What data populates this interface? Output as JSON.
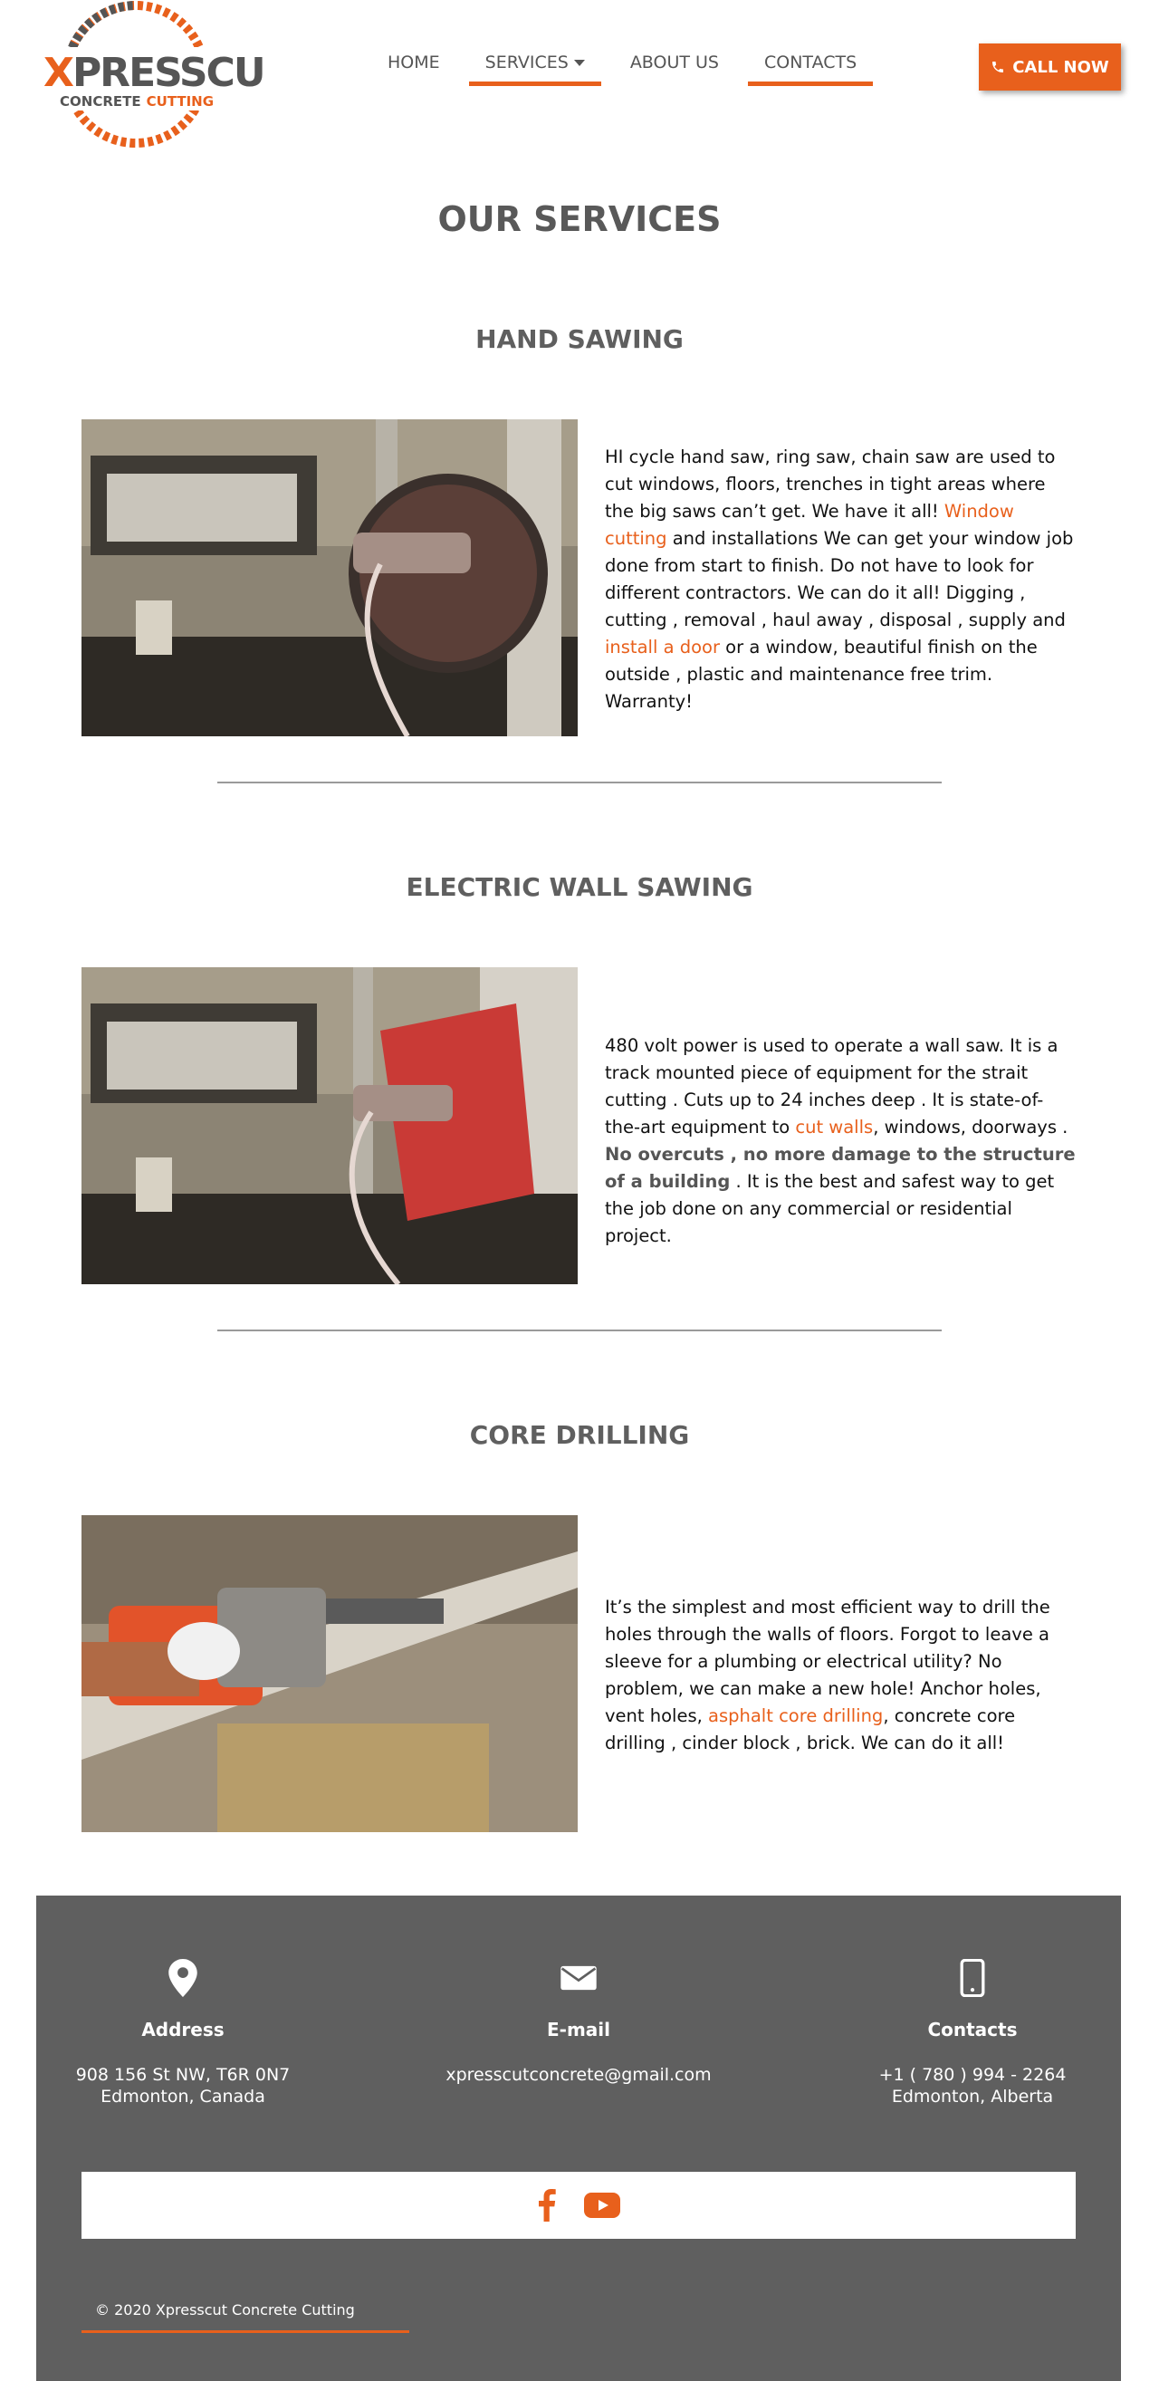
{
  "brand": {
    "name_accent": "X",
    "name_rest": "PRESSCUT",
    "tagline_a": "CONCRETE",
    "tagline_b": "CUTTING",
    "accent_color": "#e8601c",
    "dark_color": "#5f5f5f"
  },
  "nav": {
    "items": [
      {
        "label": "HOME",
        "active": false
      },
      {
        "label": "SERVICES",
        "active": true,
        "has_dropdown": true
      },
      {
        "label": "ABOUT US",
        "active": false
      },
      {
        "label": "CONTACTS",
        "active": true
      }
    ],
    "call_label": "CALL NOW",
    "call_icon": "phone-icon"
  },
  "page": {
    "title": "OUR SERVICES"
  },
  "services": [
    {
      "title": "HAND SAWING",
      "image": "hand-saw-photo",
      "text_1": "HI cycle hand saw, ring saw, chain saw are used to cut windows, floors, trenches in tight areas where the big saws can’t get. We have it all! ",
      "link_1": "Window cutting",
      "text_2": " and installations We can get your window job done from start to finish. Do not have to look for different contractors. We can do it all! Digging , cutting , removal , haul away , disposal , supply and ",
      "link_2": "install a door",
      "text_3": " or a window, beautiful finish on the outside , plastic and maintenance free trim. Warranty!"
    },
    {
      "title": "ELECTRIC WALL SAWING",
      "image": "wall-saw-photo",
      "text_1": "480 volt power is used to operate a wall saw. It is a track mounted piece of equipment for the strait cutting . Cuts up to 24 inches deep . It is state-of-the-art equipment to ",
      "link_1": "cut walls",
      "text_2": ", windows, doorways . ",
      "bold_1": "No overcuts , no more damage to the structure of a building",
      "text_3": " . It is the best and safest way to get the job done on any commercial or residential project."
    },
    {
      "title": "CORE DRILLING",
      "image": "core-drill-photo",
      "text_1": "It’s the simplest and most efficient way to drill the holes through the walls of floors. Forgot to leave a sleeve for a plumbing or electrical utility? No problem, we can make a new hole! Anchor holes, vent holes, ",
      "link_1": "asphalt core drilling",
      "text_2": ", concrete core drilling , cinder block , brick. We can do it all!"
    }
  ],
  "footer": {
    "address": {
      "icon": "location-pin-icon",
      "label": "Address",
      "line1": "908 156 St NW, T6R 0N7",
      "line2": "Edmonton, Canada"
    },
    "email": {
      "icon": "envelope-icon",
      "label": "E-mail",
      "line1": "xpresscutconcrete@gmail.com"
    },
    "contacts": {
      "icon": "mobile-phone-icon",
      "label": "Contacts",
      "line1": "+1 ( 780 ) 994 - 2264",
      "line2": "Edmonton, Alberta"
    },
    "social": [
      "facebook-icon",
      "youtube-icon"
    ],
    "copyright": "© 2020 Xpresscut Concrete Cutting"
  }
}
